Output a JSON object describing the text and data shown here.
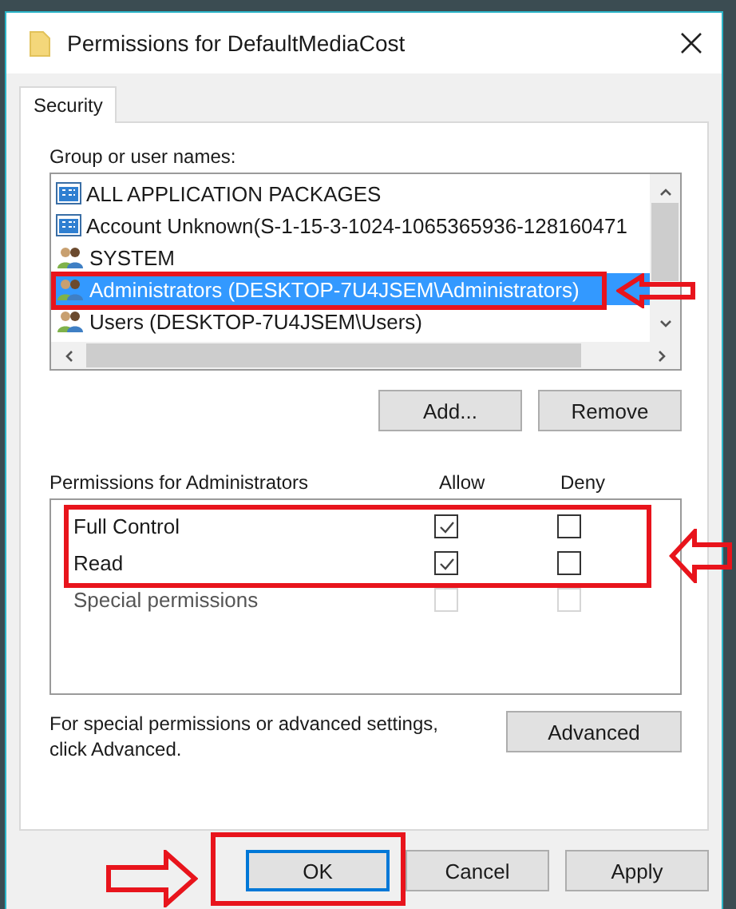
{
  "window": {
    "title": "Permissions for DefaultMediaCost"
  },
  "tabs": [
    {
      "label": "Security",
      "selected": true
    }
  ],
  "group_label": "Group or user names:",
  "users": [
    {
      "kind": "package",
      "name": "ALL APPLICATION PACKAGES",
      "selected": false
    },
    {
      "kind": "package",
      "name": "Account Unknown(S-1-15-3-1024-1065365936-128160471",
      "selected": false
    },
    {
      "kind": "group",
      "name": "SYSTEM",
      "selected": false
    },
    {
      "kind": "group",
      "name": "Administrators (DESKTOP-7U4JSEM\\Administrators)",
      "selected": true
    },
    {
      "kind": "group",
      "name": "Users (DESKTOP-7U4JSEM\\Users)",
      "selected": false
    }
  ],
  "user_buttons": [
    "Add...",
    "Remove"
  ],
  "permissions": {
    "title": "Permissions for Administrators",
    "allow_header": "Allow",
    "deny_header": "Deny",
    "rows": [
      {
        "name": "Full Control",
        "allow": true,
        "deny": false,
        "disabled": false
      },
      {
        "name": "Read",
        "allow": true,
        "deny": false,
        "disabled": false
      },
      {
        "name": "Special permissions",
        "allow": false,
        "deny": false,
        "disabled": true
      }
    ]
  },
  "advanced_note": "For special permissions or advanced settings, click Advanced.",
  "advanced_button": "Advanced",
  "buttons": [
    {
      "label": "OK",
      "default": true
    },
    {
      "label": "Cancel",
      "default": false
    },
    {
      "label": "Apply",
      "default": false
    }
  ]
}
